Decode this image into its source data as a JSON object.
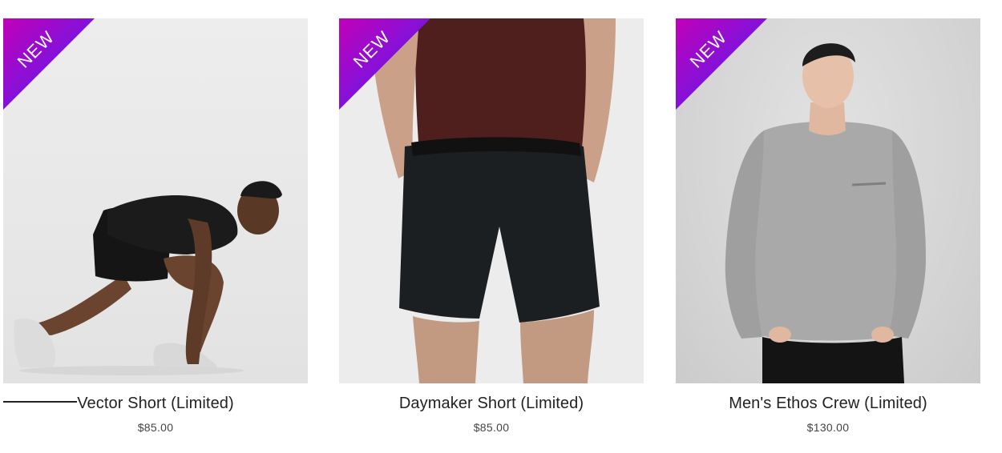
{
  "products": [
    {
      "badge": "NEW",
      "name": "Vector Short (Limited)",
      "price": "$85.00",
      "image": "man-in-starting-stance-photo"
    },
    {
      "badge": "NEW",
      "name": "Daymaker Short (Limited)",
      "price": "$85.00",
      "image": "black-shorts-model-photo"
    },
    {
      "badge": "NEW",
      "name": "Men's Ethos Crew (Limited)",
      "price": "$130.00",
      "image": "grey-crew-sweater-model-photo"
    }
  ],
  "colors": {
    "badge_start": "#c200b8",
    "badge_end": "#4a16e8",
    "text": "#222222",
    "price": "#444444"
  }
}
